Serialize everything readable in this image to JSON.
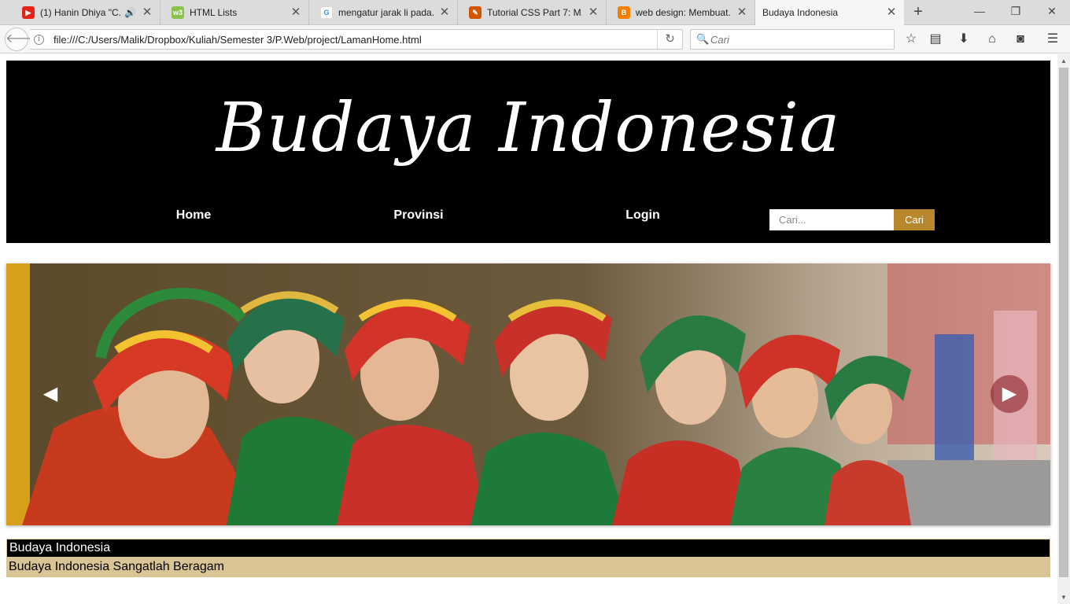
{
  "browser": {
    "tabs": [
      {
        "title": "(1) Hanin Dhiya \"C...",
        "icon": "youtube-icon",
        "color": "#e62117",
        "audio": true
      },
      {
        "title": "HTML Lists",
        "icon": "w3schools-icon",
        "color": "#8bc34a"
      },
      {
        "title": "mengatur jarak li pada...",
        "icon": "google-icon",
        "color": "#4285f4"
      },
      {
        "title": "Tutorial CSS Part 7: M...",
        "icon": "tools-icon",
        "color": "#d35400"
      },
      {
        "title": "web design: Membuat...",
        "icon": "blogger-icon",
        "color": "#f57d00"
      },
      {
        "title": "Budaya Indonesia",
        "icon": "page-icon",
        "color": "#999999",
        "active": true
      }
    ],
    "url": "file:///C:/Users/Malik/Dropbox/Kuliah/Semester 3/P.Web/project/LamanHome.html",
    "search_placeholder": "Cari"
  },
  "site": {
    "logo": "Budaya Indonesia",
    "nav": [
      {
        "label": "Home"
      },
      {
        "label": "Provinsi"
      },
      {
        "label": "Login"
      }
    ],
    "search": {
      "placeholder": "Cari...",
      "button": "Cari"
    },
    "slider": {
      "prev": "◀",
      "next": "▶"
    },
    "info": {
      "title": "Budaya Indonesia",
      "text": "Budaya Indonesia Sangatlah Beragam"
    }
  },
  "colors": {
    "header_bg": "#000000",
    "accent": "#b8862c",
    "info_bg": "#d9c496"
  }
}
